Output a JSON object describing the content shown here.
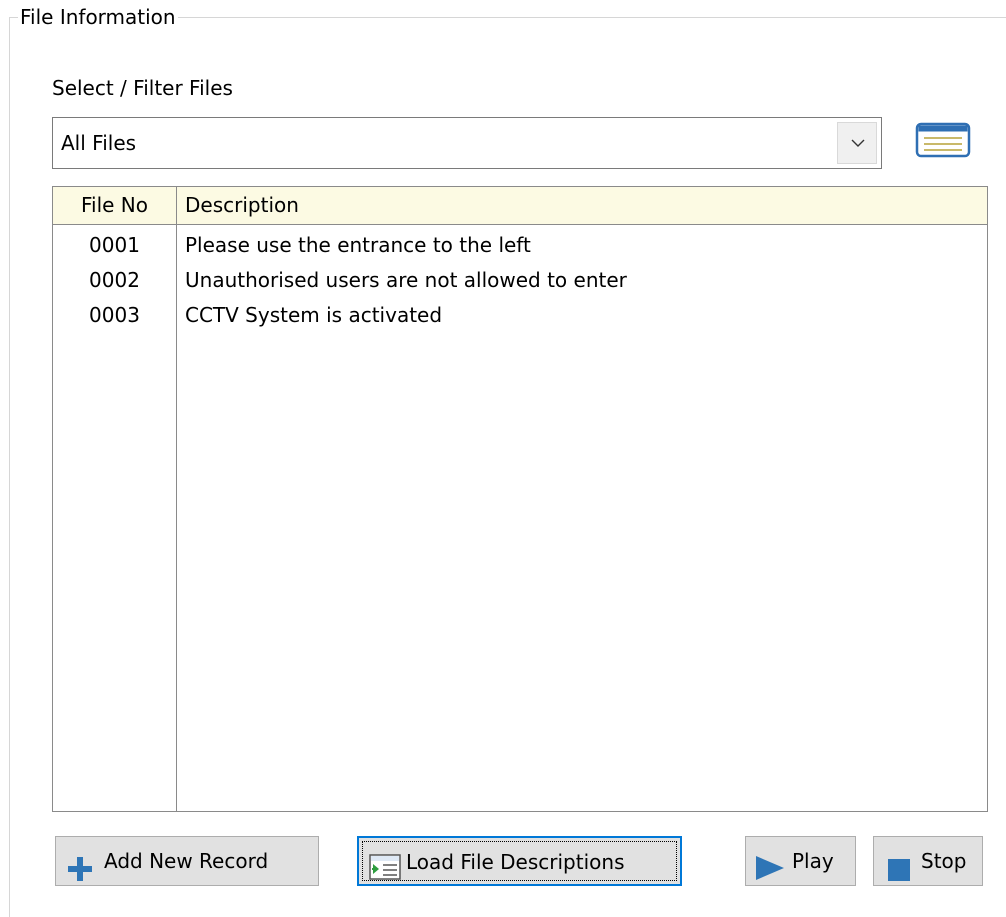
{
  "group": {
    "title": "File Information"
  },
  "filter": {
    "label": "Select / Filter Files",
    "selected": "All Files",
    "dropdown_icon": "chevron-down-icon",
    "side_icon": "list-view-icon"
  },
  "table": {
    "headers": {
      "file_no": "File No",
      "description": "Description"
    },
    "rows": [
      {
        "file_no": "0001",
        "description": "Please use the entrance to the left"
      },
      {
        "file_no": "0002",
        "description": "Unauthorised users are not allowed to enter"
      },
      {
        "file_no": "0003",
        "description": "CCTV System is activated"
      }
    ],
    "header_bg": "#fcfae3"
  },
  "buttons": {
    "add": {
      "label": "Add New Record",
      "icon": "plus-icon"
    },
    "load": {
      "label": "Load File Descriptions",
      "icon": "import-file-icon"
    },
    "play": {
      "label": "Play",
      "icon": "play-icon"
    },
    "stop": {
      "label": "Stop",
      "icon": "stop-icon"
    }
  },
  "colors": {
    "accent": "#2e75b6",
    "focus": "#0078d7"
  }
}
